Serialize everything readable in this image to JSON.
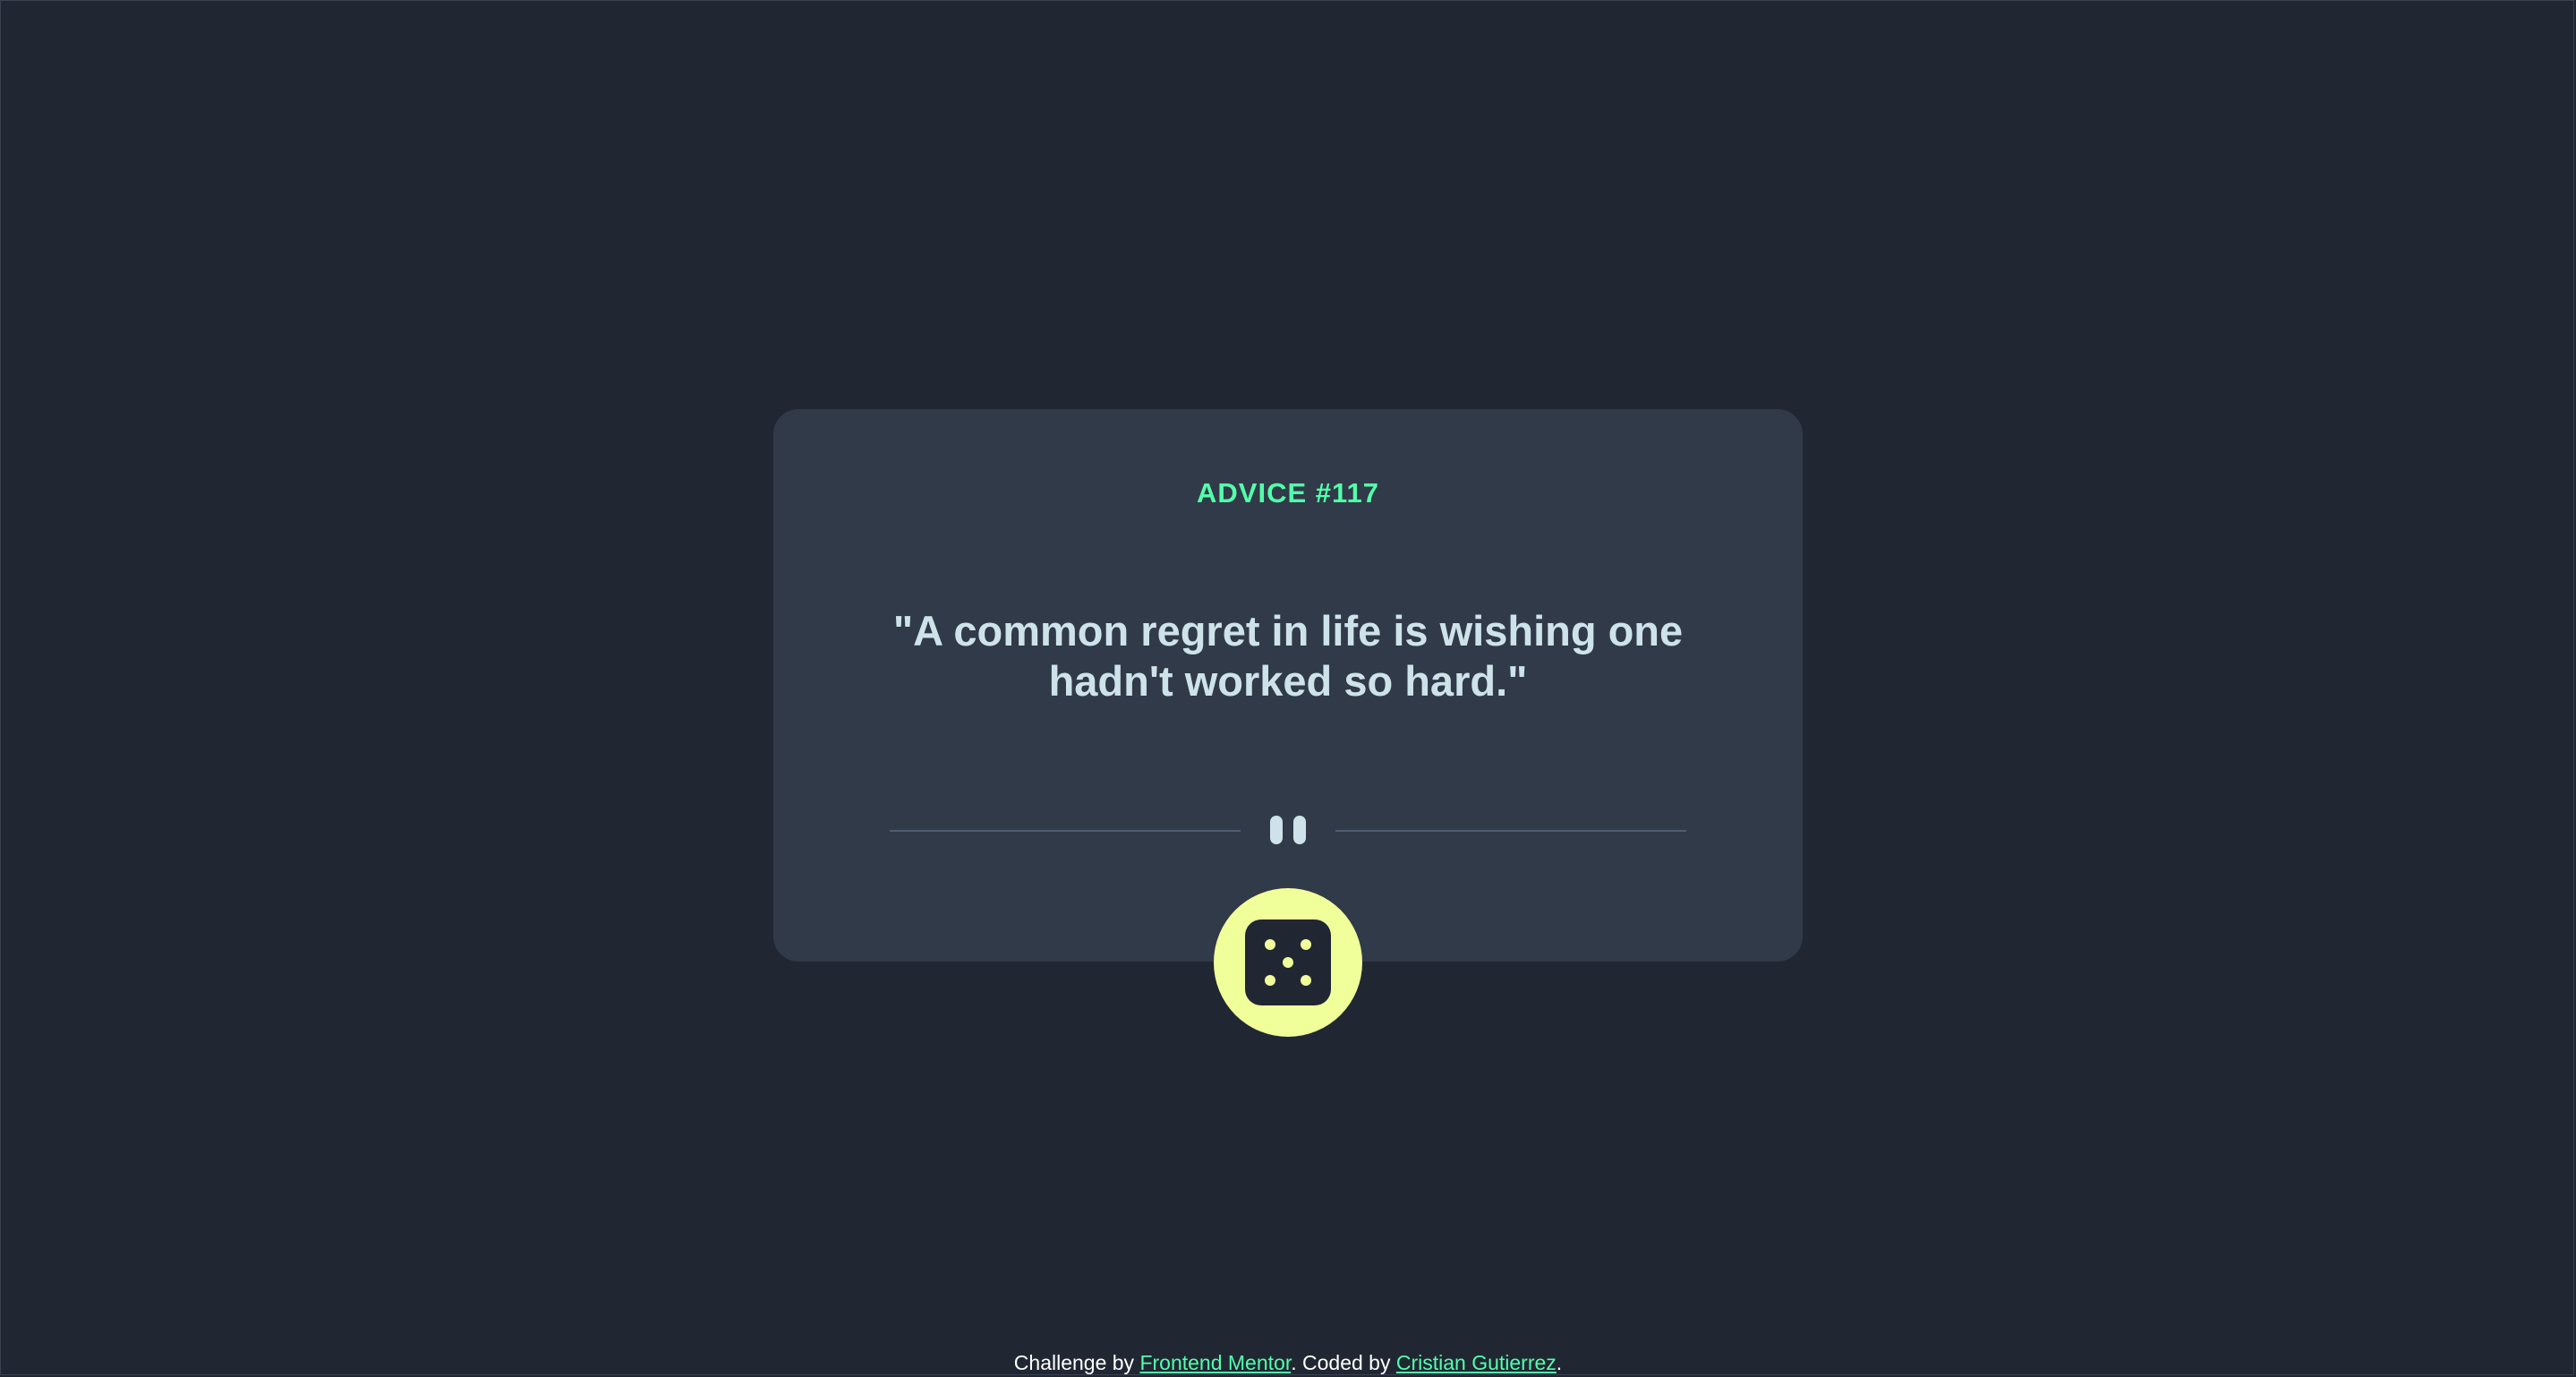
{
  "card": {
    "advice_label": "ADVICE #117",
    "advice_text": "\"A common regret in life is wishing one hadn't worked so hard.\""
  },
  "footer": {
    "prefix": "Challenge by ",
    "challenge_link": "Frontend Mentor",
    "middle": ". Coded by ",
    "author_link": "Cristian Gutierrez",
    "suffix": "."
  },
  "icons": {
    "divider": "pause-icon",
    "button": "dice-icon"
  },
  "colors": {
    "background": "#202733",
    "card": "#313a48",
    "accent_green": "#53ffaa",
    "text_light": "#cee3e9",
    "button_yellow": "#f1ff9b",
    "divider_line": "#4f5d74"
  }
}
